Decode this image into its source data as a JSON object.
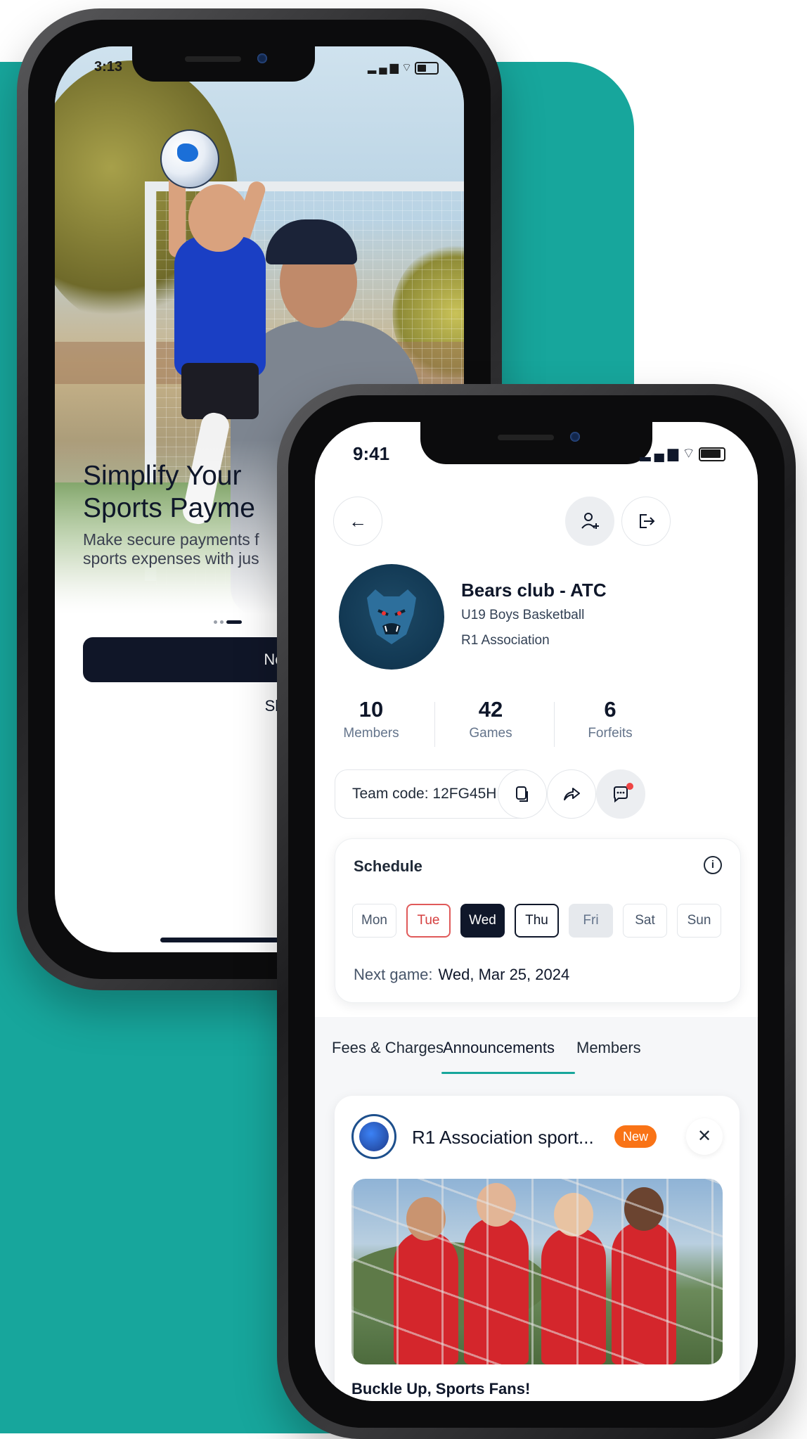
{
  "back_phone": {
    "status": {
      "time": "3:13"
    },
    "onboarding": {
      "title_line1": "Simplify Your",
      "title_line2": "Sports Payme",
      "subtitle_line1": "Make secure payments f",
      "subtitle_line2": "sports expenses with jus",
      "next_label": "Next",
      "skip_label": "Skip"
    }
  },
  "front_phone": {
    "status": {
      "time": "9:41"
    },
    "header": {
      "back_icon": "arrow-left-icon",
      "add_member_icon": "user-plus-icon",
      "leave_icon": "exit-icon"
    },
    "team": {
      "name": "Bears club - ATC",
      "league": "U19 Boys Basketball",
      "association": "R1 Association"
    },
    "stats": [
      {
        "value": "10",
        "label": "Members"
      },
      {
        "value": "42",
        "label": "Games"
      },
      {
        "value": "6",
        "label": "Forfeits"
      }
    ],
    "team_code": "Team code: 12FG45H",
    "schedule": {
      "title": "Schedule",
      "days": [
        "Mon",
        "Tue",
        "Wed",
        "Thu",
        "Fri",
        "Sat",
        "Sun"
      ],
      "next_game_label": "Next game:",
      "next_game_value": "Wed, Mar 25, 2024"
    },
    "tabs": [
      "Fees & Charges",
      "Announcements",
      "Members"
    ],
    "active_tab": "Announcements",
    "announcement": {
      "org_name": "R1 Association sport...",
      "badge": "New",
      "headline": "Buckle Up, Sports Fans!"
    }
  },
  "colors": {
    "teal": "#17a69c",
    "navy": "#0f172a",
    "badge_orange": "#f97316",
    "tue_red": "#e05a5a"
  }
}
